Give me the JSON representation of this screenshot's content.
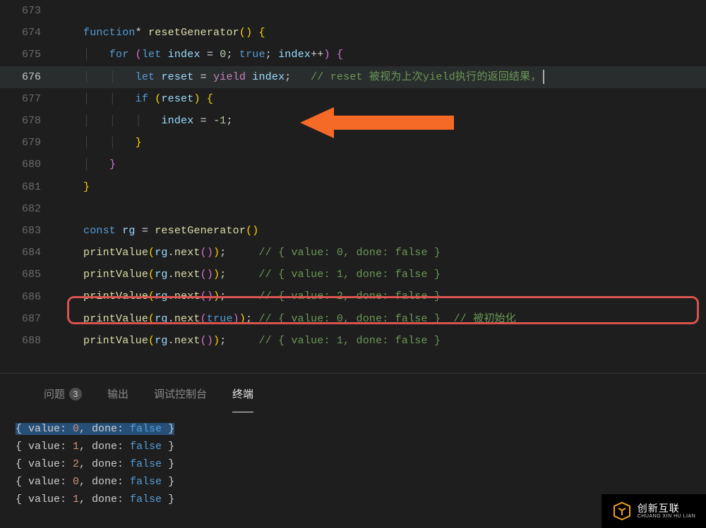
{
  "lines": [
    {
      "n": "673",
      "ind": 0,
      "text": ""
    },
    {
      "n": "674",
      "ind": 0,
      "tokens": [
        {
          "t": "function",
          "c": "kw-storage"
        },
        {
          "t": "* ",
          "c": "op"
        },
        {
          "t": "resetGenerator",
          "c": "fn-name"
        },
        {
          "t": "(",
          "c": "paren"
        },
        {
          "t": ") ",
          "c": "paren"
        },
        {
          "t": "{",
          "c": "brace"
        }
      ]
    },
    {
      "n": "675",
      "ind": 1,
      "tokens": [
        {
          "t": "for ",
          "c": "kw-storage"
        },
        {
          "t": "(",
          "c": "paren2"
        },
        {
          "t": "let ",
          "c": "kw-storage"
        },
        {
          "t": "index",
          "c": "ident"
        },
        {
          "t": " = ",
          "c": "op"
        },
        {
          "t": "0",
          "c": "num"
        },
        {
          "t": "; ",
          "c": "punct"
        },
        {
          "t": "true",
          "c": "bool"
        },
        {
          "t": "; ",
          "c": "punct"
        },
        {
          "t": "index",
          "c": "ident"
        },
        {
          "t": "++",
          "c": "op"
        },
        {
          "t": ")",
          "c": "paren2"
        },
        {
          "t": " ",
          "c": "op"
        },
        {
          "t": "{",
          "c": "brace2"
        }
      ]
    },
    {
      "n": "676",
      "ind": 2,
      "current": true,
      "tokens": [
        {
          "t": "let ",
          "c": "kw-storage"
        },
        {
          "t": "reset",
          "c": "ident"
        },
        {
          "t": " = ",
          "c": "op"
        },
        {
          "t": "yield ",
          "c": "kw-control"
        },
        {
          "t": "index",
          "c": "ident"
        },
        {
          "t": ";   ",
          "c": "punct"
        },
        {
          "t": "// reset 被视为上次yield执行的返回结果，",
          "c": "comment"
        }
      ],
      "cursor": true
    },
    {
      "n": "677",
      "ind": 2,
      "tokens": [
        {
          "t": "if ",
          "c": "kw-storage"
        },
        {
          "t": "(",
          "c": "paren"
        },
        {
          "t": "reset",
          "c": "ident"
        },
        {
          "t": ") ",
          "c": "paren"
        },
        {
          "t": "{",
          "c": "brace"
        }
      ]
    },
    {
      "n": "678",
      "ind": 3,
      "tokens": [
        {
          "t": "index",
          "c": "ident"
        },
        {
          "t": " = ",
          "c": "op"
        },
        {
          "t": "-",
          "c": "op"
        },
        {
          "t": "1",
          "c": "num"
        },
        {
          "t": ";",
          "c": "punct"
        }
      ]
    },
    {
      "n": "679",
      "ind": 2,
      "tokens": [
        {
          "t": "}",
          "c": "brace"
        }
      ]
    },
    {
      "n": "680",
      "ind": 1,
      "tokens": [
        {
          "t": "}",
          "c": "brace2"
        }
      ]
    },
    {
      "n": "681",
      "ind": 0,
      "tokens": [
        {
          "t": "}",
          "c": "brace"
        }
      ]
    },
    {
      "n": "682",
      "ind": 0,
      "text": ""
    },
    {
      "n": "683",
      "ind": 0,
      "tokens": [
        {
          "t": "const ",
          "c": "kw-storage"
        },
        {
          "t": "rg",
          "c": "ident"
        },
        {
          "t": " = ",
          "c": "op"
        },
        {
          "t": "resetGenerator",
          "c": "fn-name"
        },
        {
          "t": "(",
          "c": "paren"
        },
        {
          "t": ")",
          "c": "paren"
        }
      ]
    },
    {
      "n": "684",
      "ind": 0,
      "tokens": [
        {
          "t": "printValue",
          "c": "fn-name"
        },
        {
          "t": "(",
          "c": "paren"
        },
        {
          "t": "rg",
          "c": "ident"
        },
        {
          "t": ".",
          "c": "punct"
        },
        {
          "t": "next",
          "c": "fn-name"
        },
        {
          "t": "(",
          "c": "paren2"
        },
        {
          "t": ")",
          "c": "paren2"
        },
        {
          "t": ")",
          "c": "paren"
        },
        {
          "t": ";     ",
          "c": "punct"
        },
        {
          "t": "// { value: 0, done: false }",
          "c": "comment"
        }
      ]
    },
    {
      "n": "685",
      "ind": 0,
      "tokens": [
        {
          "t": "printValue",
          "c": "fn-name"
        },
        {
          "t": "(",
          "c": "paren"
        },
        {
          "t": "rg",
          "c": "ident"
        },
        {
          "t": ".",
          "c": "punct"
        },
        {
          "t": "next",
          "c": "fn-name"
        },
        {
          "t": "(",
          "c": "paren2"
        },
        {
          "t": ")",
          "c": "paren2"
        },
        {
          "t": ")",
          "c": "paren"
        },
        {
          "t": ";     ",
          "c": "punct"
        },
        {
          "t": "// { value: 1, done: false }",
          "c": "comment"
        }
      ]
    },
    {
      "n": "686",
      "ind": 0,
      "tokens": [
        {
          "t": "printValue",
          "c": "fn-name"
        },
        {
          "t": "(",
          "c": "paren"
        },
        {
          "t": "rg",
          "c": "ident"
        },
        {
          "t": ".",
          "c": "punct"
        },
        {
          "t": "next",
          "c": "fn-name"
        },
        {
          "t": "(",
          "c": "paren2"
        },
        {
          "t": ")",
          "c": "paren2"
        },
        {
          "t": ")",
          "c": "paren"
        },
        {
          "t": ";     ",
          "c": "punct"
        },
        {
          "t": "// { value: 2, done: false }",
          "c": "comment"
        }
      ]
    },
    {
      "n": "687",
      "ind": 0,
      "tokens": [
        {
          "t": "printValue",
          "c": "fn-name"
        },
        {
          "t": "(",
          "c": "paren"
        },
        {
          "t": "rg",
          "c": "ident"
        },
        {
          "t": ".",
          "c": "punct"
        },
        {
          "t": "next",
          "c": "fn-name"
        },
        {
          "t": "(",
          "c": "paren2"
        },
        {
          "t": "true",
          "c": "bool"
        },
        {
          "t": ")",
          "c": "paren2"
        },
        {
          "t": ")",
          "c": "paren"
        },
        {
          "t": "; ",
          "c": "punct"
        },
        {
          "t": "// { value: 0, done: false }  // 被初始化",
          "c": "comment"
        }
      ]
    },
    {
      "n": "688",
      "ind": 0,
      "tokens": [
        {
          "t": "printValue",
          "c": "fn-name"
        },
        {
          "t": "(",
          "c": "paren"
        },
        {
          "t": "rg",
          "c": "ident"
        },
        {
          "t": ".",
          "c": "punct"
        },
        {
          "t": "next",
          "c": "fn-name"
        },
        {
          "t": "(",
          "c": "paren2"
        },
        {
          "t": ")",
          "c": "paren2"
        },
        {
          "t": ")",
          "c": "paren"
        },
        {
          "t": ";     ",
          "c": "punct"
        },
        {
          "t": "// { value: 1, done: false }",
          "c": "comment"
        }
      ]
    }
  ],
  "tabs": {
    "problems": "问题",
    "problems_count": "3",
    "output": "输出",
    "debug": "调试控制台",
    "terminal": "终端"
  },
  "terminal_lines": [
    {
      "val": "0",
      "sel": true
    },
    {
      "val": "1",
      "sel": false
    },
    {
      "val": "2",
      "sel": false
    },
    {
      "val": "0",
      "sel": false
    },
    {
      "val": "1",
      "sel": false
    }
  ],
  "logo": {
    "brand": "创新互联",
    "en": "CHUANG XIN HU LIAN"
  }
}
